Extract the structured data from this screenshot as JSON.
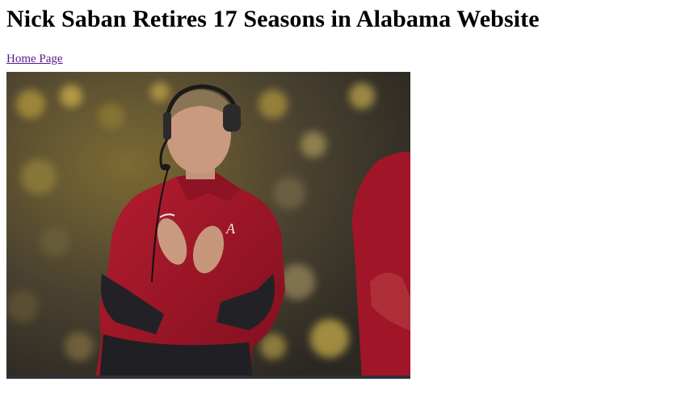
{
  "page": {
    "title": "Nick Saban Retires 17 Seasons in Alabama Website",
    "nav_link_label": "Home Page"
  },
  "photo": {
    "subject": "Coach in crimson Alabama jacket with headset, clapping on the sideline",
    "colors": {
      "jacket": "#a3162a",
      "sleeves": "#1e1e22",
      "crowd_gold": "#9a8330",
      "crowd_dark": "#3a3428",
      "skin": "#c99a7f",
      "hair": "#8a7456"
    }
  }
}
